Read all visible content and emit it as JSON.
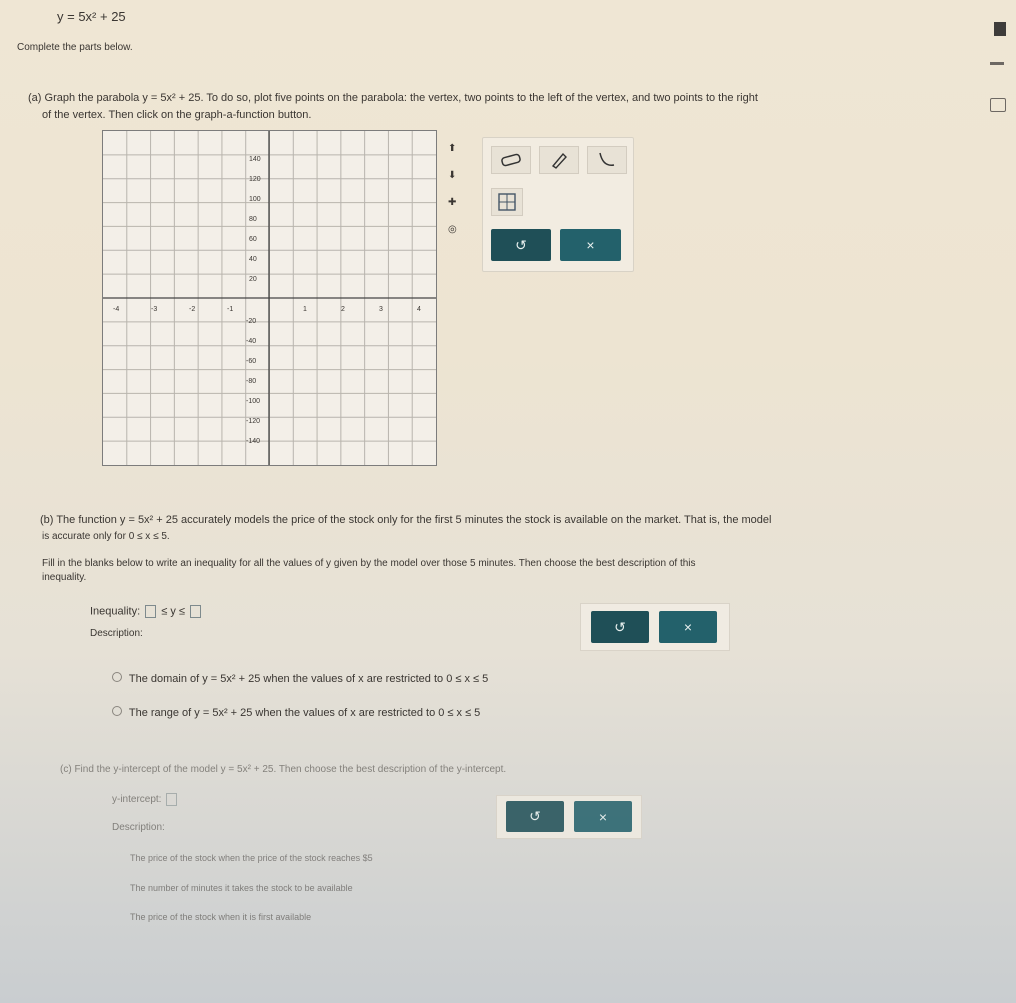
{
  "equation_header": "y = 5x² + 25",
  "instruction": "Complete the parts below.",
  "part_a": {
    "label": "(a)",
    "text_line1": "Graph the parabola y = 5x² + 25. To do so, plot five points on the parabola: the vertex, two points to the left of the vertex, and two points to the right",
    "text_line2": "of the vertex. Then click on the graph-a-function button."
  },
  "graph": {
    "x_ticks": [
      "-4",
      "-3",
      "-2",
      "-1",
      "1",
      "2",
      "3",
      "4"
    ],
    "y_ticks_pos": [
      "140",
      "120",
      "100",
      "80",
      "60",
      "40",
      "20"
    ],
    "y_ticks_neg": [
      "-20",
      "-40",
      "-60",
      "-80",
      "-100",
      "-120",
      "-140"
    ]
  },
  "tools": {
    "eraser_icon": "eraser-icon",
    "pencil_icon": "pencil-icon",
    "parabola_icon": "parabola-icon",
    "grid_icon": "grid-icon",
    "undo": "↺",
    "clear": "×"
  },
  "part_b": {
    "label": "(b)",
    "text_line1": "The function y = 5x² + 25 accurately models the price of the stock only for the first 5 minutes the stock is available on the market. That is, the model",
    "text_line2": "is accurate only for 0 ≤ x ≤ 5.",
    "instr_line1": "Fill in the blanks below to write an inequality for all the values of y given by the model over those 5 minutes. Then choose the best description of this",
    "instr_line2": "inequality.",
    "inequality_label": "Inequality:",
    "inequality_mid": "≤ y ≤",
    "description_label": "Description:",
    "option1": "The domain of y = 5x² + 25 when the values of x are restricted to 0 ≤ x ≤ 5",
    "option2": "The range of y = 5x² + 25 when the values of x are restricted to 0 ≤ x ≤ 5",
    "undo": "↺",
    "clear": "×"
  },
  "part_c": {
    "label": "(c)",
    "text": "Find the y-intercept of the model y = 5x² + 25. Then choose the best description of the y-intercept.",
    "intercept_label": "y-intercept:",
    "description_label": "Description:",
    "option1": "The price of the stock when the price of the stock reaches $5",
    "option2": "The number of minutes it takes the stock to be available",
    "option3": "The price of the stock when it is first available",
    "undo": "↺",
    "clear": "×"
  }
}
